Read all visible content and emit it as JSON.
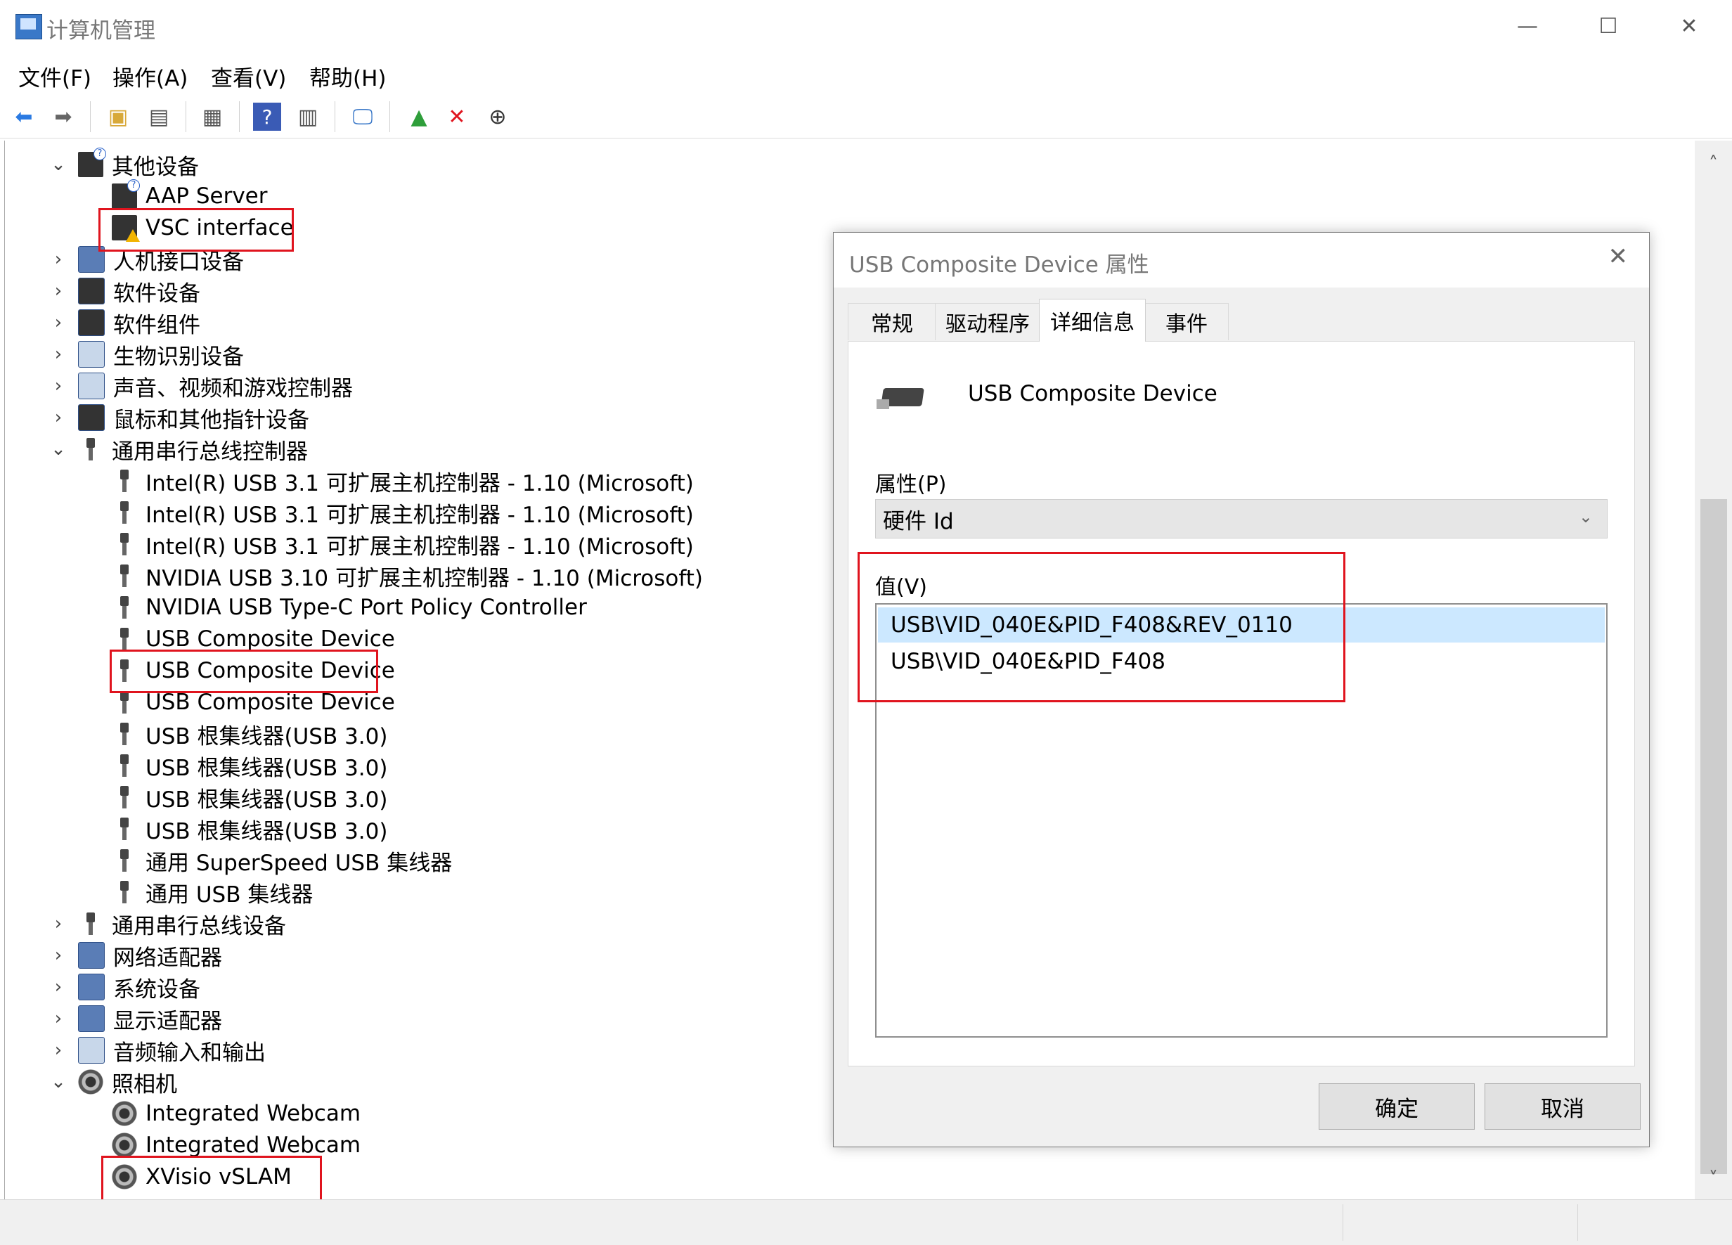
{
  "window": {
    "title": "计算机管理",
    "minimize": "—",
    "maximize": "☐",
    "close": "✕"
  },
  "menu": [
    "文件(F)",
    "操作(A)",
    "查看(V)",
    "帮助(H)"
  ],
  "toolbar_icons": [
    "back-icon",
    "forward-icon",
    "up-folder-icon",
    "console-tree-icon",
    "properties-icon",
    "help-icon",
    "action-pane-icon",
    "computer-icon",
    "update-driver-icon",
    "uninstall-icon",
    "scan-hardware-icon"
  ],
  "tree": {
    "rows": [
      {
        "label": "其他设备",
        "level": 0,
        "expand": "open",
        "icon": "other-devices-icon"
      },
      {
        "label": "AAP Server",
        "level": 1,
        "icon": "unknown-device-icon"
      },
      {
        "label": "VSC interface",
        "level": 1,
        "icon": "warning-device-icon"
      },
      {
        "label": "人机接口设备",
        "level": 0,
        "expand": "closed",
        "icon": "hid-icon"
      },
      {
        "label": "软件设备",
        "level": 0,
        "expand": "closed",
        "icon": "software-device-icon"
      },
      {
        "label": "软件组件",
        "level": 0,
        "expand": "closed",
        "icon": "software-component-icon"
      },
      {
        "label": "生物识别设备",
        "level": 0,
        "expand": "closed",
        "icon": "biometric-icon"
      },
      {
        "label": "声音、视频和游戏控制器",
        "level": 0,
        "expand": "closed",
        "icon": "sound-icon"
      },
      {
        "label": "鼠标和其他指针设备",
        "level": 0,
        "expand": "closed",
        "icon": "mouse-icon"
      },
      {
        "label": "通用串行总线控制器",
        "level": 0,
        "expand": "open",
        "icon": "usb-icon"
      },
      {
        "label": "Intel(R) USB 3.1 可扩展主机控制器 - 1.10 (Microsoft)",
        "level": 1,
        "icon": "usb-icon"
      },
      {
        "label": "Intel(R) USB 3.1 可扩展主机控制器 - 1.10 (Microsoft)",
        "level": 1,
        "icon": "usb-icon"
      },
      {
        "label": "Intel(R) USB 3.1 可扩展主机控制器 - 1.10 (Microsoft)",
        "level": 1,
        "icon": "usb-icon"
      },
      {
        "label": "NVIDIA USB 3.10 可扩展主机控制器 - 1.10 (Microsoft)",
        "level": 1,
        "icon": "usb-icon"
      },
      {
        "label": "NVIDIA USB Type-C Port Policy Controller",
        "level": 1,
        "icon": "usb-icon"
      },
      {
        "label": "USB Composite Device",
        "level": 1,
        "icon": "usb-icon"
      },
      {
        "label": "USB Composite Device",
        "level": 1,
        "icon": "usb-icon"
      },
      {
        "label": "USB Composite Device",
        "level": 1,
        "icon": "usb-icon"
      },
      {
        "label": "USB 根集线器(USB 3.0)",
        "level": 1,
        "icon": "usb-icon"
      },
      {
        "label": "USB 根集线器(USB 3.0)",
        "level": 1,
        "icon": "usb-icon"
      },
      {
        "label": "USB 根集线器(USB 3.0)",
        "level": 1,
        "icon": "usb-icon"
      },
      {
        "label": "USB 根集线器(USB 3.0)",
        "level": 1,
        "icon": "usb-icon"
      },
      {
        "label": "通用 SuperSpeed USB 集线器",
        "level": 1,
        "icon": "usb-icon"
      },
      {
        "label": "通用 USB 集线器",
        "level": 1,
        "icon": "usb-icon"
      },
      {
        "label": "通用串行总线设备",
        "level": 0,
        "expand": "closed",
        "icon": "usb-icon"
      },
      {
        "label": "网络适配器",
        "level": 0,
        "expand": "closed",
        "icon": "network-icon"
      },
      {
        "label": "系统设备",
        "level": 0,
        "expand": "closed",
        "icon": "system-icon"
      },
      {
        "label": "显示适配器",
        "level": 0,
        "expand": "closed",
        "icon": "display-icon"
      },
      {
        "label": "音频输入和输出",
        "level": 0,
        "expand": "closed",
        "icon": "audio-icon"
      },
      {
        "label": "照相机",
        "level": 0,
        "expand": "open",
        "icon": "camera-icon"
      },
      {
        "label": "Integrated Webcam",
        "level": 1,
        "icon": "camera-icon"
      },
      {
        "label": "Integrated Webcam",
        "level": 1,
        "icon": "camera-icon"
      },
      {
        "label": "XVisio vSLAM",
        "level": 1,
        "icon": "camera-icon"
      }
    ]
  },
  "dialog": {
    "title": "USB Composite Device 属性",
    "close": "✕",
    "tabs": [
      "常规",
      "驱动程序",
      "详细信息",
      "事件"
    ],
    "active_tab": "详细信息",
    "device_name": "USB Composite Device",
    "property_label": "属性(P)",
    "property_selected": "硬件 Id",
    "value_label": "值(V)",
    "values": [
      "USB\\VID_040E&PID_F408&REV_0110",
      "USB\\VID_040E&PID_F408"
    ],
    "ok": "确定",
    "cancel": "取消"
  },
  "colors": {
    "highlight_red": "#e0141e",
    "selected_row": "#cce8ff"
  }
}
